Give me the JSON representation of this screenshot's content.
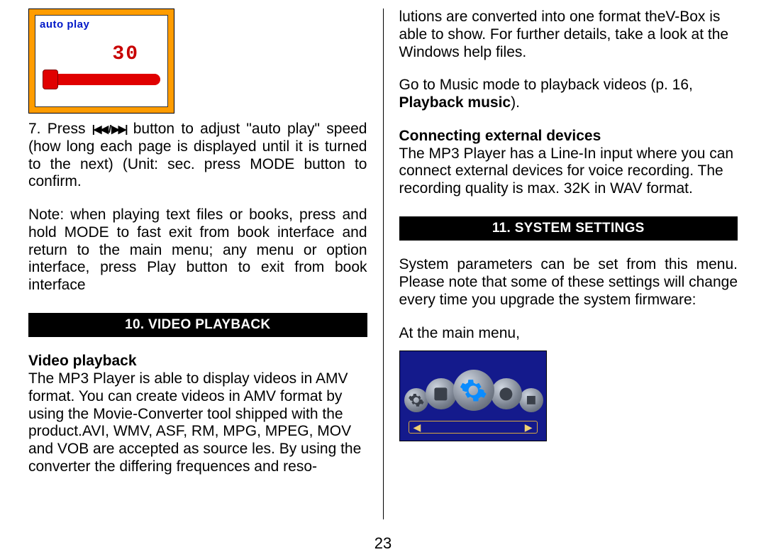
{
  "autoplay_thumb": {
    "title": "auto play",
    "value": "30"
  },
  "left": {
    "p1_a": "7. Press ",
    "p1_b": " button to adjust \"auto play\" speed (how long each page is displayed until it is turned to the next) (Unit: sec. press MODE button to confirm.",
    "p2": "Note: when playing text files or books, press and hold MODE to fast exit from book interface and return to the main menu; any menu or option interface, press Play button to exit from book interface",
    "section": "10. VIDEO PLAYBACK",
    "sub": "Video playback",
    "p3": "The MP3 Player is able to display videos in AMV format. You can create videos in AMV format by using the Movie-Converter tool shipped with the product.AVI, WMV, ASF, RM, MPG, MPEG, MOV and VOB are accepted as source  les. By using the converter the differing frequences and reso-"
  },
  "right": {
    "p1": "lutions are converted into one format theV-Box is able to show. For further details, take a look at the Windows help files.",
    "p2_a": "Go to Music mode  to playback videos (p. 16, ",
    "p2_bold": "Playback music",
    "p2_b": ").",
    "sub": "Connecting external devices",
    "p3": "The MP3 Player has a Line-In input where you can connect external devices for voice recording. The recording quality is max. 32K in WAV format.",
    "section": "11. SYSTEM SETTINGS",
    "p4": "System parameters can be set from this menu.  Please note that some of these settings will change every time you upgrade the system firmware:",
    "p5": "At the main menu,"
  },
  "page_number": "23"
}
